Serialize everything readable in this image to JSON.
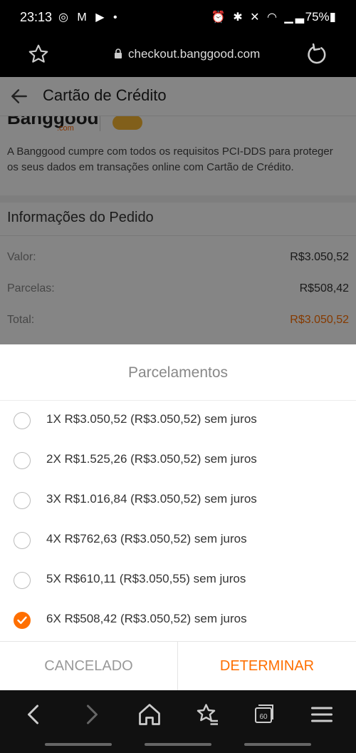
{
  "status_bar": {
    "time": "23:13",
    "battery": "75%",
    "left_icons": [
      "instagram-icon",
      "gmail-icon",
      "youtube-icon",
      "dot-icon"
    ],
    "right_icons": [
      "alarm-icon",
      "bluetooth-icon",
      "mute-icon",
      "wifi-icon",
      "signal-icon",
      "battery-icon"
    ]
  },
  "browser": {
    "url": "checkout.banggood.com"
  },
  "header": {
    "title": "Cartão de Crédito"
  },
  "background": {
    "logo_text": "Banggood",
    "logo_sub": ".com",
    "pci_text": "A Banggood cumpre com todos os requisitos PCI-DDS para proteger os seus dados em transações online com Cartão de Crédito.",
    "order_title": "Informações do Pedido",
    "rows": [
      {
        "label": "Valor:",
        "value": "R$3.050,52"
      },
      {
        "label": "Parcelas:",
        "value": "R$508,42"
      },
      {
        "label": "Total:",
        "value": "R$3.050,52"
      }
    ]
  },
  "sheet": {
    "title": "Parcelamentos",
    "options": [
      {
        "label": "1X R$3.050,52 (R$3.050,52) sem juros",
        "selected": false
      },
      {
        "label": "2X R$1.525,26 (R$3.050,52) sem juros",
        "selected": false
      },
      {
        "label": "3X R$1.016,84 (R$3.050,52) sem juros",
        "selected": false
      },
      {
        "label": "4X R$762,63 (R$3.050,52) sem juros",
        "selected": false
      },
      {
        "label": "5X R$610,11 (R$3.050,55) sem juros",
        "selected": false
      },
      {
        "label": "6X R$508,42 (R$3.050,52) sem juros",
        "selected": true
      }
    ],
    "cancel_label": "CANCELADO",
    "confirm_label": "DETERMINAR"
  },
  "nav": {
    "tab_count": "60"
  },
  "colors": {
    "accent": "#ff6f00",
    "overlay": "rgba(0,0,0,0.48)"
  }
}
